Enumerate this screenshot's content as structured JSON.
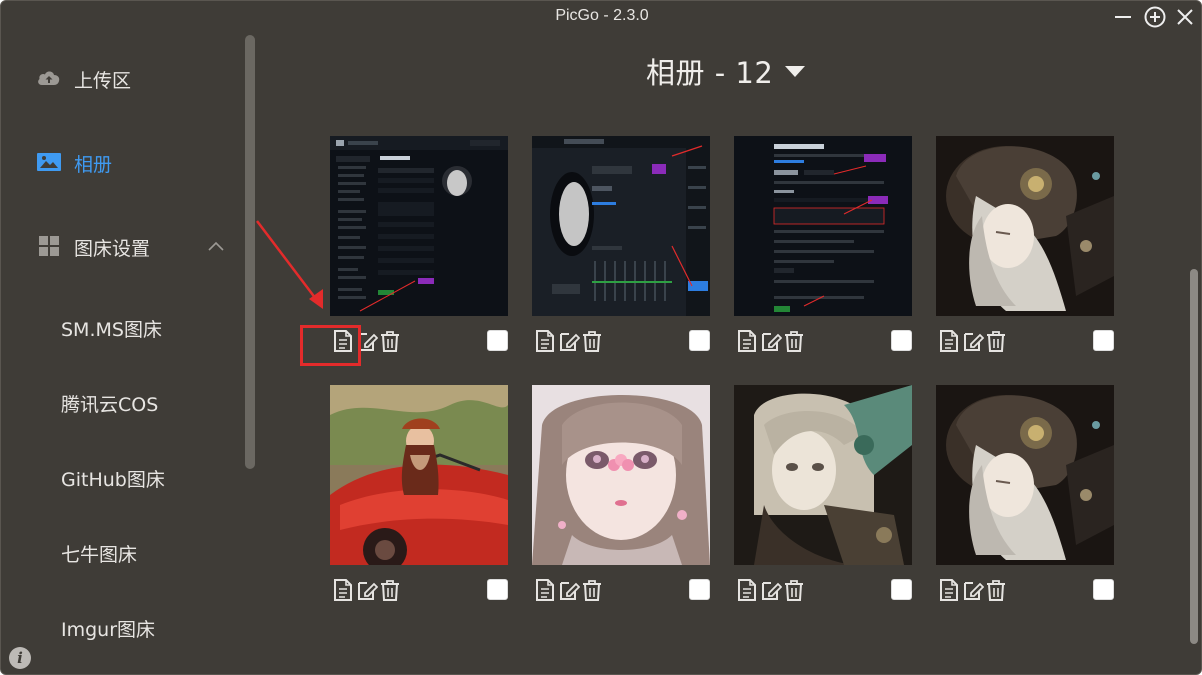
{
  "window": {
    "title": "PicGo - 2.3.0",
    "controls": [
      "minimize-icon",
      "add-icon",
      "close-icon"
    ]
  },
  "sidebar": {
    "items": [
      {
        "label": "上传区",
        "icon": "upload-cloud-icon",
        "active": false
      },
      {
        "label": "相册",
        "icon": "image-icon",
        "active": true
      },
      {
        "label": "图床设置",
        "icon": "grid-icon",
        "active": false,
        "expanded": true
      }
    ],
    "sub_items": [
      {
        "label": "SM.MS图床"
      },
      {
        "label": "腾讯云COS"
      },
      {
        "label": "GitHub图床"
      },
      {
        "label": "七牛图床"
      },
      {
        "label": "Imgur图床"
      }
    ],
    "info_icon": "i"
  },
  "gallery": {
    "title": "相册 - 12",
    "count": 12,
    "accent": "#3f9af1",
    "images": [
      {
        "kind": "screenshot-profile"
      },
      {
        "kind": "screenshot-music"
      },
      {
        "kind": "screenshot-settings"
      },
      {
        "kind": "anime-girl-hat"
      },
      {
        "kind": "photo-red-car"
      },
      {
        "kind": "anime-girl-pink"
      },
      {
        "kind": "anime-girl-dark"
      },
      {
        "kind": "anime-girl-hat"
      }
    ],
    "actions": [
      "copy-link-icon",
      "edit-icon",
      "delete-icon"
    ],
    "annotation_color": "#e32b2b"
  }
}
